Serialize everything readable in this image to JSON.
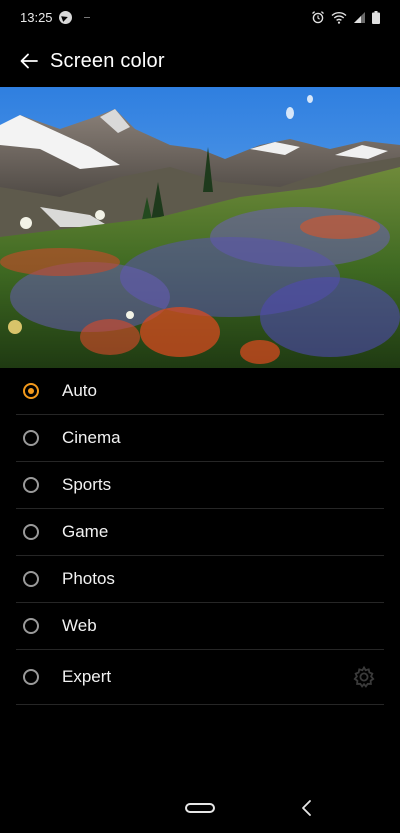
{
  "status_bar": {
    "time": "13:25",
    "left_icons": [
      "telegram-icon"
    ],
    "right_icons": [
      "alarm-icon",
      "wifi-icon",
      "signal-icon",
      "battery-icon"
    ]
  },
  "header": {
    "back_icon": "arrow-left-icon",
    "title": "Screen color"
  },
  "preview": {
    "image": "mountain wildflower meadow"
  },
  "options": [
    {
      "label": "Auto",
      "selected": true
    },
    {
      "label": "Cinema",
      "selected": false
    },
    {
      "label": "Sports",
      "selected": false
    },
    {
      "label": "Game",
      "selected": false
    },
    {
      "label": "Photos",
      "selected": false
    },
    {
      "label": "Web",
      "selected": false
    },
    {
      "label": "Expert",
      "selected": false,
      "settings_icon": "gear-icon"
    }
  ],
  "nav_bar": {
    "icons": [
      "home-pill-icon",
      "back-chevron-icon"
    ]
  },
  "colors": {
    "accent": "#f39a1c",
    "background": "#000000",
    "divider": "#262626",
    "text": "#f2f2f2"
  }
}
